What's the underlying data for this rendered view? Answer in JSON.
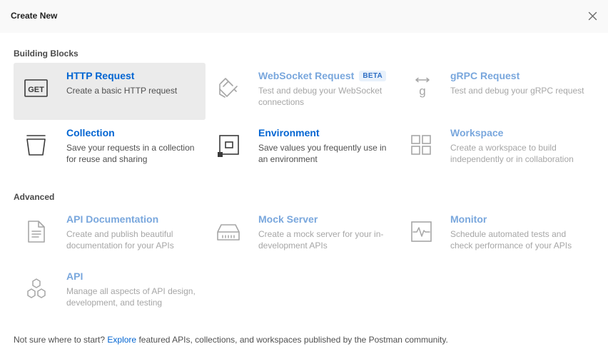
{
  "dialog": {
    "title": "Create New"
  },
  "sections": {
    "building_blocks": "Building Blocks",
    "advanced": "Advanced"
  },
  "items": {
    "http": {
      "name": "HTTP Request",
      "desc": "Create a basic HTTP request",
      "icon": "http-get-icon"
    },
    "websocket": {
      "name": "WebSocket Request",
      "badge": "BETA",
      "desc": "Test and debug your WebSocket connections",
      "icon": "websocket-icon"
    },
    "grpc": {
      "name": "gRPC Request",
      "desc": "Test and debug your gRPC request",
      "icon": "grpc-icon"
    },
    "collection": {
      "name": "Collection",
      "desc": "Save your requests in a collection for reuse and sharing",
      "icon": "collection-icon"
    },
    "environment": {
      "name": "Environment",
      "desc": "Save values you frequently use in an environment",
      "icon": "environment-icon"
    },
    "workspace": {
      "name": "Workspace",
      "desc": "Create a workspace to build independently or in collaboration",
      "icon": "workspace-icon"
    },
    "api_docs": {
      "name": "API Documentation",
      "desc": "Create and publish beautiful documentation for your APIs",
      "icon": "document-icon"
    },
    "mock_server": {
      "name": "Mock Server",
      "desc": "Create a mock server for your in-development APIs",
      "icon": "server-icon"
    },
    "monitor": {
      "name": "Monitor",
      "desc": "Schedule automated tests and check performance of your APIs",
      "icon": "monitor-icon"
    },
    "api": {
      "name": "API",
      "desc": "Manage all aspects of API design, development, and testing",
      "icon": "hexagons-icon"
    }
  },
  "footer": {
    "prefix": "Not sure where to start?",
    "link": "Explore",
    "suffix": "featured APIs, collections, and workspaces published by the Postman community."
  },
  "colors": {
    "link": "#0265d2",
    "link_dim": "#79a7dd",
    "selected_bg": "#ebebeb",
    "header_bg": "#f9f9f9"
  }
}
